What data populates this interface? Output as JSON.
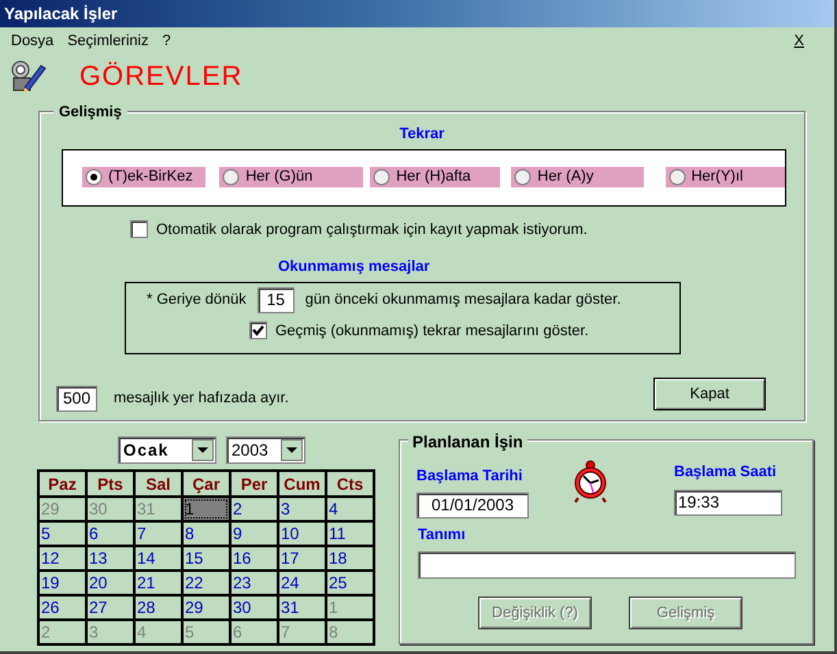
{
  "window": {
    "title": "Yapılacak İşler"
  },
  "menu": [
    {
      "label": "Dosya"
    },
    {
      "label": "Seçimleriniz"
    },
    {
      "label": "?"
    }
  ],
  "close_label": "X",
  "heading": "GÖREVLER",
  "advanced": {
    "title": "Gelişmiş",
    "repeat_title": "Tekrar",
    "repeat_options": [
      {
        "label": "(T)ek-BirKez",
        "selected": true
      },
      {
        "label": "Her (G)ün",
        "selected": false
      },
      {
        "label": "Her (H)afta",
        "selected": false
      },
      {
        "label": "Her (A)y",
        "selected": false
      },
      {
        "label": "Her(Y)ıl",
        "selected": false
      }
    ],
    "autorun": {
      "label": "Otomatik olarak program  çalıştırmak için kayıt yapmak istiyorum.",
      "checked": false
    },
    "unread_title": "Okunmamış mesajlar",
    "unread_prefix": "*  Geriye dönük",
    "unread_days": "15",
    "unread_suffix": "gün önceki  okunmamış mesajlara kadar göster.",
    "show_past": {
      "label": "Geçmiş (okunmamış) tekrar mesajlarını göster.",
      "checked": true
    },
    "buffer_value": "500",
    "buffer_label": "mesajlık yer hafızada ayır.",
    "close_button": "Kapat"
  },
  "calendar": {
    "month": "Ocak",
    "year": "2003",
    "weekdays": [
      "Paz",
      "Pts",
      "Sal",
      "Çar",
      "Per",
      "Cum",
      "Cts"
    ],
    "weeks": [
      [
        {
          "day": "29",
          "outside": true,
          "selected": false
        },
        {
          "day": "30",
          "outside": true,
          "selected": false
        },
        {
          "day": "31",
          "outside": true,
          "selected": false
        },
        {
          "day": "1",
          "outside": false,
          "selected": true
        },
        {
          "day": "2",
          "outside": false,
          "selected": false
        },
        {
          "day": "3",
          "outside": false,
          "selected": false
        },
        {
          "day": "4",
          "outside": false,
          "selected": false
        }
      ],
      [
        {
          "day": "5",
          "outside": false,
          "selected": false
        },
        {
          "day": "6",
          "outside": false,
          "selected": false
        },
        {
          "day": "7",
          "outside": false,
          "selected": false
        },
        {
          "day": "8",
          "outside": false,
          "selected": false
        },
        {
          "day": "9",
          "outside": false,
          "selected": false
        },
        {
          "day": "10",
          "outside": false,
          "selected": false
        },
        {
          "day": "11",
          "outside": false,
          "selected": false
        }
      ],
      [
        {
          "day": "12",
          "outside": false,
          "selected": false
        },
        {
          "day": "13",
          "outside": false,
          "selected": false
        },
        {
          "day": "14",
          "outside": false,
          "selected": false
        },
        {
          "day": "15",
          "outside": false,
          "selected": false
        },
        {
          "day": "16",
          "outside": false,
          "selected": false
        },
        {
          "day": "17",
          "outside": false,
          "selected": false
        },
        {
          "day": "18",
          "outside": false,
          "selected": false
        }
      ],
      [
        {
          "day": "19",
          "outside": false,
          "selected": false
        },
        {
          "day": "20",
          "outside": false,
          "selected": false
        },
        {
          "day": "21",
          "outside": false,
          "selected": false
        },
        {
          "day": "22",
          "outside": false,
          "selected": false
        },
        {
          "day": "23",
          "outside": false,
          "selected": false
        },
        {
          "day": "24",
          "outside": false,
          "selected": false
        },
        {
          "day": "25",
          "outside": false,
          "selected": false
        }
      ],
      [
        {
          "day": "26",
          "outside": false,
          "selected": false
        },
        {
          "day": "27",
          "outside": false,
          "selected": false
        },
        {
          "day": "28",
          "outside": false,
          "selected": false
        },
        {
          "day": "29",
          "outside": false,
          "selected": false
        },
        {
          "day": "30",
          "outside": false,
          "selected": false
        },
        {
          "day": "31",
          "outside": false,
          "selected": false
        },
        {
          "day": "1",
          "outside": true,
          "selected": false
        }
      ],
      [
        {
          "day": "2",
          "outside": true,
          "selected": false
        },
        {
          "day": "3",
          "outside": true,
          "selected": false
        },
        {
          "day": "4",
          "outside": true,
          "selected": false
        },
        {
          "day": "5",
          "outside": true,
          "selected": false
        },
        {
          "day": "6",
          "outside": true,
          "selected": false
        },
        {
          "day": "7",
          "outside": true,
          "selected": false
        },
        {
          "day": "8",
          "outside": true,
          "selected": false
        }
      ]
    ]
  },
  "planned": {
    "title": "Planlanan İşin",
    "start_date_label": "Başlama Tarihi",
    "start_date": "01/01/2003",
    "start_time_label": "Başlama Saati",
    "start_time": "19:33",
    "description_label": "Tanımı",
    "buttons": [
      {
        "label": "Değişiklik (?)",
        "disabled": true
      },
      {
        "label": "Gelişmiş",
        "disabled": true
      }
    ]
  }
}
